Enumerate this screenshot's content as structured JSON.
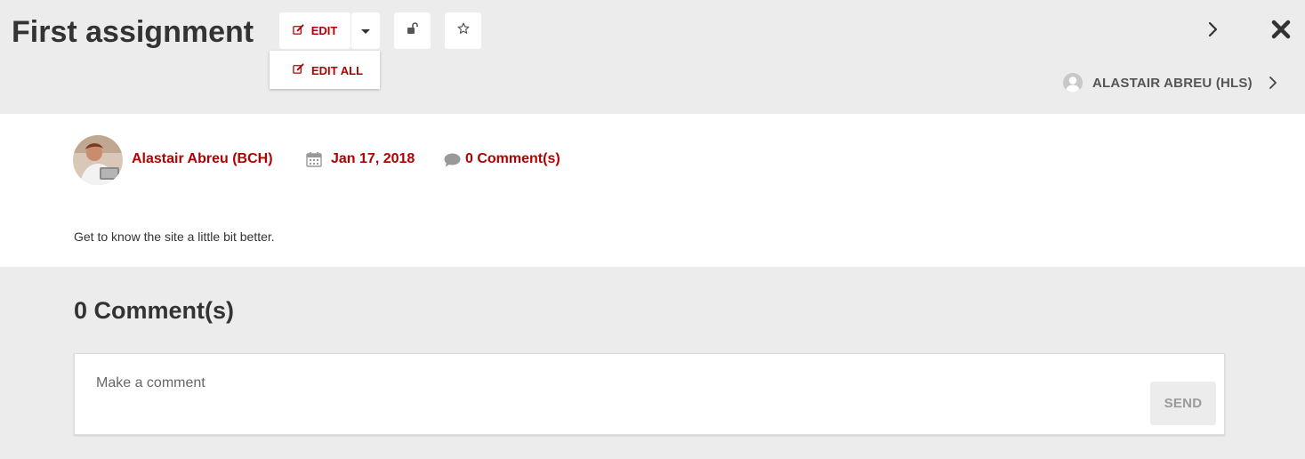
{
  "header": {
    "title": "First assignment",
    "edit_label": "EDIT",
    "edit_all_label": "EDIT ALL",
    "user_name": "ALASTAIR ABREU (HLS)"
  },
  "post": {
    "author": "Alastair Abreu (BCH)",
    "date": "Jan 17, 2018",
    "comment_count_label": "0 Comment(s)",
    "description": "Get to know the site a little bit better."
  },
  "comments": {
    "heading": "0 Comment(s)",
    "placeholder": "Make a comment",
    "send_label": "SEND"
  },
  "icons": {
    "edit": "pencil-square-icon",
    "caret": "caret-down-icon",
    "lock": "unlock-icon",
    "star": "star-outline-icon",
    "next": "chevron-right-icon",
    "close": "close-icon",
    "user": "user-circle-icon",
    "calendar": "calendar-icon",
    "comment": "comment-bubble-icon"
  },
  "colors": {
    "accent": "#b30000",
    "header_bg": "#ececec",
    "text": "#333333"
  }
}
